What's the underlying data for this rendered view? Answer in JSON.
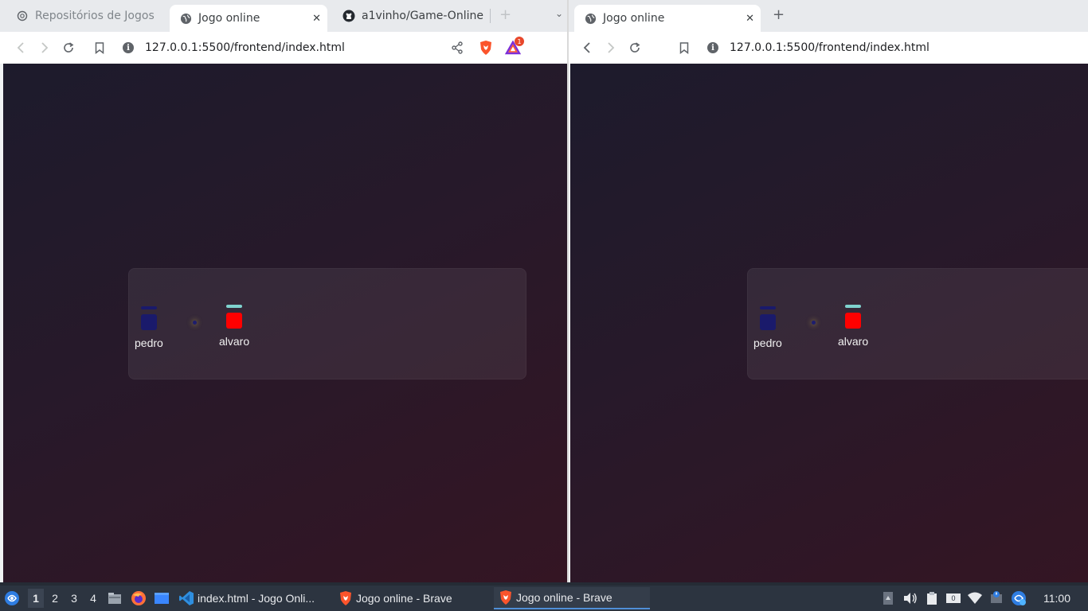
{
  "left_window": {
    "tabs": [
      {
        "label": "Repositórios de Jogos",
        "icon": "openai-icon",
        "active": false
      },
      {
        "label": "Jogo online",
        "icon": "globe-icon",
        "active": true
      },
      {
        "label": "a1vinho/Game-Online",
        "icon": "github-icon",
        "active": false
      }
    ],
    "close_symbol": "✕",
    "new_tab_symbol": "+",
    "dropdown_symbol": "⌄",
    "url": "127.0.0.1:5500/frontend/index.html",
    "brave_badge_count": "1"
  },
  "right_window": {
    "tabs": [
      {
        "label": "Jogo online",
        "icon": "globe-icon",
        "active": true
      }
    ],
    "close_symbol": "✕",
    "new_tab_symbol": "+",
    "url": "127.0.0.1:5500/frontend/index.html"
  },
  "game": {
    "players": [
      {
        "name": "pedro",
        "color": "#1a1a6b",
        "health_bar_color": "#1a1a6b"
      },
      {
        "name": "alvaro",
        "color": "#ff0000",
        "health_bar_color": "#7fd3cf"
      }
    ]
  },
  "taskbar": {
    "workspaces": [
      "1",
      "2",
      "3",
      "4"
    ],
    "current_workspace": "1",
    "tasks": [
      {
        "label": "index.html - Jogo Onli...",
        "icon": "vscode-icon"
      },
      {
        "label": "Jogo online - Brave",
        "icon": "brave-icon"
      },
      {
        "label": "Jogo online - Brave",
        "icon": "brave-icon",
        "active": true
      }
    ],
    "battery_badge": "0",
    "clock": "11:00"
  }
}
